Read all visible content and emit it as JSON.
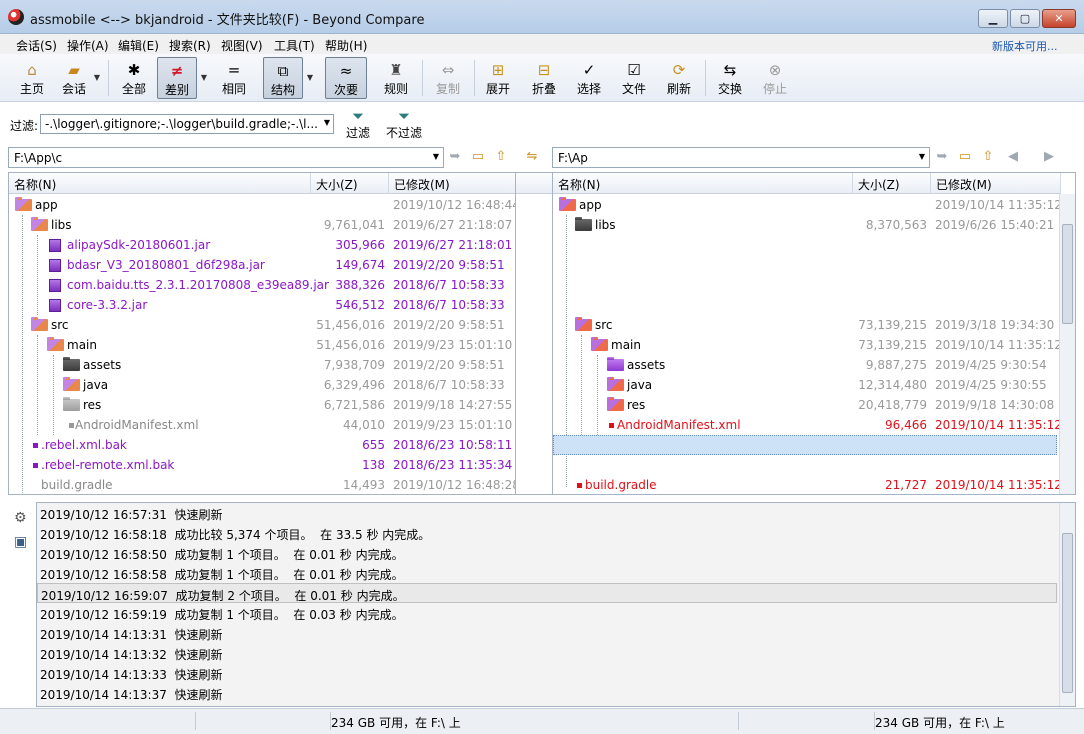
{
  "window": {
    "title": "assmobile <--> bkjandroid - 文件夹比较(F) - Beyond Compare",
    "minimize": "▁",
    "maximize": "▢",
    "close": "✕"
  },
  "menu": {
    "items": [
      "会话(S)",
      "操作(A)",
      "编辑(E)",
      "搜索(R)",
      "视图(V)",
      "工具(T)",
      "帮助(H)"
    ],
    "new_version": "新版本可用..."
  },
  "toolbar": {
    "home": "主页",
    "session": "会话",
    "all": "全部",
    "diff": "差别",
    "same": "相同",
    "structure": "结构",
    "minor": "次要",
    "rules": "规则",
    "copy": "复制",
    "expand": "展开",
    "collapse": "折叠",
    "select": "选择",
    "files": "文件",
    "refresh": "刷新",
    "swap": "交换",
    "stop": "停止"
  },
  "filter": {
    "label": "过滤:",
    "value": "-.\\logger\\.gitignore;-.\\logger\\build.gradle;-.\\l...",
    "apply": "过滤",
    "clear": "不过滤"
  },
  "left": {
    "path": "F:\\App\\c",
    "headers": {
      "name": "名称(N)",
      "size": "大小(Z)",
      "modified": "已修改(M)"
    },
    "rows": [
      {
        "name": "app",
        "size": "",
        "date": "2019/10/12 16:48:44"
      },
      {
        "name": "libs",
        "size": "9,761,041",
        "date": "2019/6/27 21:18:07"
      },
      {
        "name": "alipaySdk-20180601.jar",
        "size": "305,966",
        "date": "2019/6/27 21:18:01"
      },
      {
        "name": "bdasr_V3_20180801_d6f298a.jar",
        "size": "149,674",
        "date": "2019/2/20 9:58:51"
      },
      {
        "name": "com.baidu.tts_2.3.1.20170808_e39ea89.jar",
        "size": "388,326",
        "date": "2018/6/7 10:58:33"
      },
      {
        "name": "core-3.3.2.jar",
        "size": "546,512",
        "date": "2018/6/7 10:58:33"
      },
      {
        "name": "src",
        "size": "51,456,016",
        "date": "2019/2/20 9:58:51"
      },
      {
        "name": "main",
        "size": "51,456,016",
        "date": "2019/9/23 15:01:10"
      },
      {
        "name": "assets",
        "size": "7,938,709",
        "date": "2019/2/20 9:58:51"
      },
      {
        "name": "java",
        "size": "6,329,496",
        "date": "2018/6/7 10:58:33"
      },
      {
        "name": "res",
        "size": "6,721,586",
        "date": "2019/9/18 14:27:55"
      },
      {
        "name": "AndroidManifest.xml",
        "size": "44,010",
        "date": "2019/9/23 15:01:10"
      },
      {
        "name": ".rebel.xml.bak",
        "size": "655",
        "date": "2018/6/23 10:58:11"
      },
      {
        "name": ".rebel-remote.xml.bak",
        "size": "138",
        "date": "2018/6/23 11:35:34"
      },
      {
        "name": "build.gradle",
        "size": "14,493",
        "date": "2019/10/12 16:48:28"
      }
    ]
  },
  "right": {
    "path": "F:\\Ap",
    "headers": {
      "name": "名称(N)",
      "size": "大小(Z)",
      "modified": "已修改(M)"
    },
    "rows": [
      {
        "name": "app",
        "size": "",
        "date": "2019/10/14 11:35:12"
      },
      {
        "name": "libs",
        "size": "8,370,563",
        "date": "2019/6/26 15:40:21"
      },
      {
        "name": "src",
        "size": "73,139,215",
        "date": "2019/3/18 19:34:30"
      },
      {
        "name": "main",
        "size": "73,139,215",
        "date": "2019/10/14 11:35:12"
      },
      {
        "name": "assets",
        "size": "9,887,275",
        "date": "2019/4/25 9:30:54"
      },
      {
        "name": "java",
        "size": "12,314,480",
        "date": "2019/4/25 9:30:55"
      },
      {
        "name": "res",
        "size": "20,418,779",
        "date": "2019/9/18 14:30:08"
      },
      {
        "name": "AndroidManifest.xml",
        "size": "96,466",
        "date": "2019/10/14 11:35:12"
      },
      {
        "name": "build.gradle",
        "size": "21,727",
        "date": "2019/10/14 11:35:12"
      }
    ]
  },
  "log": [
    {
      "time": "2019/10/12 16:57:31",
      "msg": "快速刷新"
    },
    {
      "time": "2019/10/12 16:58:18",
      "msg": "成功比较 5,374 个项目。  在 33.5 秒 内完成。"
    },
    {
      "time": "2019/10/12 16:58:50",
      "msg": "成功复制 1 个项目。  在 0.01 秒 内完成。"
    },
    {
      "time": "2019/10/12 16:58:58",
      "msg": "成功复制 1 个项目。  在 0.01 秒 内完成。"
    },
    {
      "time": "2019/10/12 16:59:07",
      "msg": "成功复制 2 个项目。  在 0.01 秒 内完成。"
    },
    {
      "time": "2019/10/12 16:59:19",
      "msg": "成功复制 1 个项目。  在 0.03 秒 内完成。"
    },
    {
      "time": "2019/10/14 14:13:31",
      "msg": "快速刷新"
    },
    {
      "time": "2019/10/14 14:13:32",
      "msg": "快速刷新"
    },
    {
      "time": "2019/10/14 14:13:33",
      "msg": "快速刷新"
    },
    {
      "time": "2019/10/14 14:13:37",
      "msg": "快速刷新"
    }
  ],
  "status": {
    "left_free": "234 GB 可用，在 F:\\ 上",
    "right_free": "234 GB 可用，在 F:\\ 上"
  },
  "colors": {
    "orphan": "#8a17c6",
    "diff": "#e0101a",
    "same": "#000000"
  }
}
